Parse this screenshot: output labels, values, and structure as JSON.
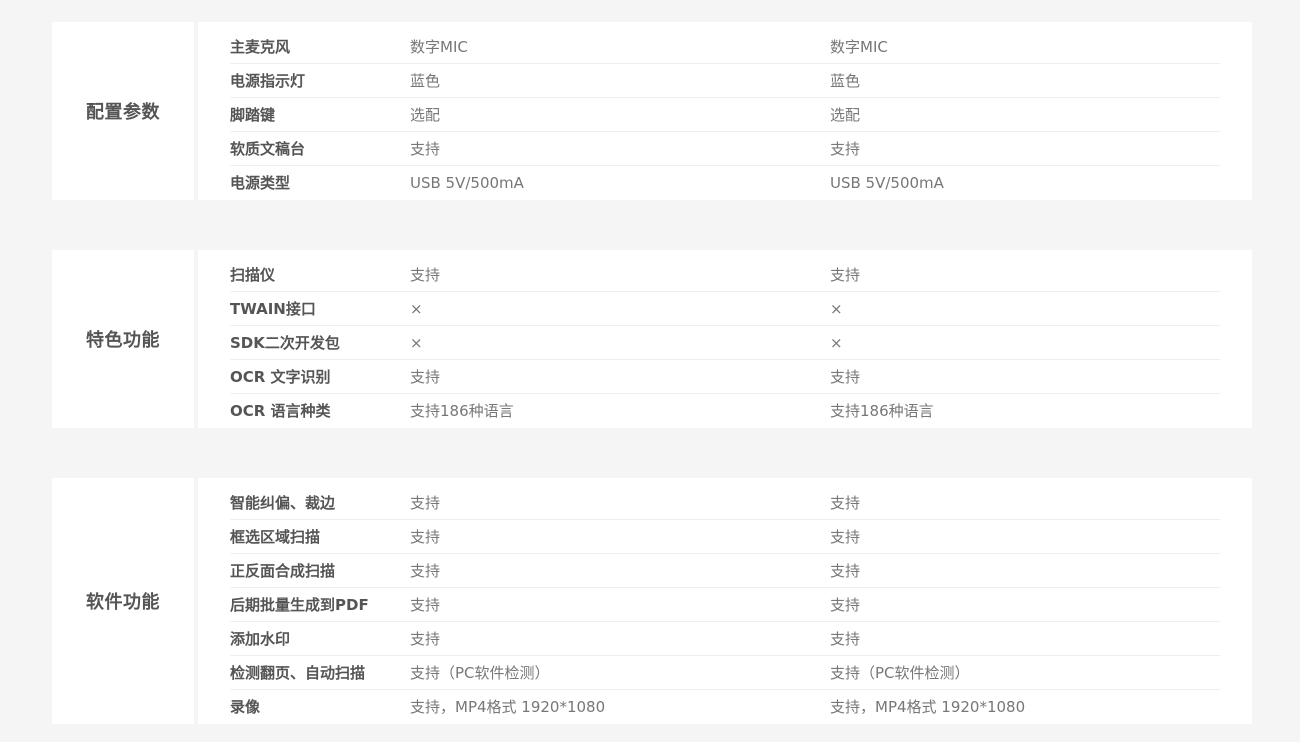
{
  "sections": [
    {
      "category": "配置参数",
      "rows": [
        {
          "label": "主麦克风",
          "v1": "数字MIC",
          "v2": "数字MIC"
        },
        {
          "label": "电源指示灯",
          "v1": "蓝色",
          "v2": "蓝色"
        },
        {
          "label": "脚踏键",
          "v1": "选配",
          "v2": "选配"
        },
        {
          "label": "软质文稿台",
          "v1": "支持",
          "v2": "支持"
        },
        {
          "label": "电源类型",
          "v1": "USB 5V/500mA",
          "v2": "USB 5V/500mA"
        }
      ]
    },
    {
      "category": "特色功能",
      "rows": [
        {
          "label": "扫描仪",
          "v1": "支持",
          "v2": "支持"
        },
        {
          "label": "TWAIN接口",
          "v1": "×",
          "v2": "×"
        },
        {
          "label": "SDK二次开发包",
          "v1": "×",
          "v2": "×"
        },
        {
          "label": "OCR 文字识别",
          "v1": "支持",
          "v2": "支持"
        },
        {
          "label": "OCR 语言种类",
          "v1": "支持186种语言",
          "v2": "支持186种语言"
        }
      ]
    },
    {
      "category": "软件功能",
      "rows": [
        {
          "label": "智能纠偏、裁边",
          "v1": "支持",
          "v2": "支持"
        },
        {
          "label": "框选区域扫描",
          "v1": "支持",
          "v2": "支持"
        },
        {
          "label": "正反面合成扫描",
          "v1": "支持",
          "v2": "支持"
        },
        {
          "label": "后期批量生成到PDF",
          "v1": "支持",
          "v2": "支持"
        },
        {
          "label": "添加水印",
          "v1": "支持",
          "v2": "支持"
        },
        {
          "label": "检测翻页、自动扫描",
          "v1": "支持（PC软件检测）",
          "v2": "支持（PC软件检测）"
        },
        {
          "label": "录像",
          "v1": "支持，MP4格式 1920*1080",
          "v2": "支持，MP4格式 1920*1080"
        }
      ]
    }
  ]
}
